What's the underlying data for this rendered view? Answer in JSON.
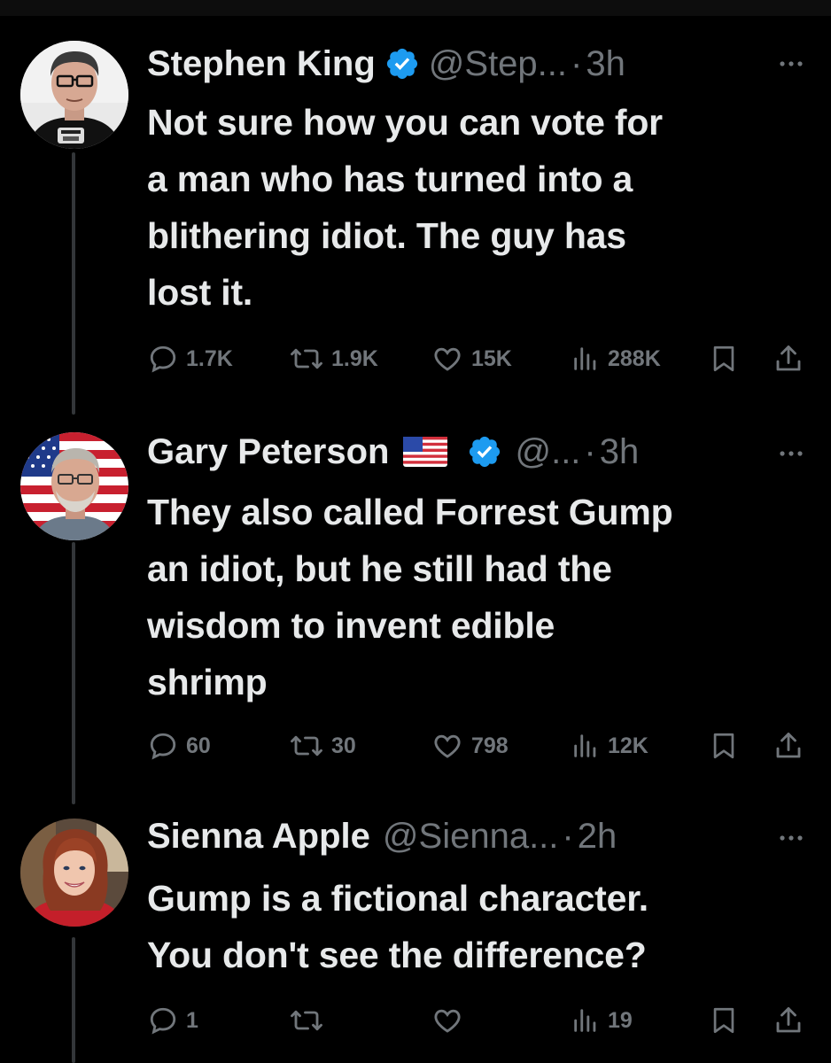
{
  "tweets": [
    {
      "display_name": "Stephen King",
      "verified": true,
      "handle": "@Step...",
      "separator": "·",
      "time": "3h",
      "text_lines": [
        "Not sure how you can vote for",
        "a man who has turned into a",
        "blithering idiot. The guy has",
        "lost it."
      ],
      "replies": "1.7K",
      "reposts": "1.9K",
      "likes": "15K",
      "views": "288K",
      "avatar": "person-glasses-black-shirt"
    },
    {
      "display_name": "Gary Peterson",
      "flag": "us-flag-emoji",
      "verified": true,
      "handle": "@...",
      "separator": "·",
      "time": "3h",
      "text_lines": [
        "They also called Forrest Gump",
        "an idiot, but he still had the",
        "wisdom to invent edible",
        "shrimp"
      ],
      "replies": "60",
      "reposts": "30",
      "likes": "798",
      "views": "12K",
      "avatar": "older-man-glasses-flag-background"
    },
    {
      "display_name": "Sienna Apple",
      "verified": false,
      "handle": "@Sienna...",
      "separator": "·",
      "time": "2h",
      "text_lines": [
        "Gump is a fictional character.",
        "You don't see the difference?"
      ],
      "replies": "1",
      "reposts": "",
      "likes": "",
      "views": "19",
      "avatar": "woman-red-hair"
    }
  ],
  "icons": {
    "reply": "reply-icon",
    "repost": "repost-icon",
    "like": "heart-icon",
    "views": "views-icon",
    "bookmark": "bookmark-icon",
    "share": "share-icon",
    "more": "more-icon",
    "verified": "verified-badge-icon"
  },
  "colors": {
    "background": "#000000",
    "text": "#e7e9ea",
    "muted": "#71767b",
    "verified": "#1d9bf0",
    "thread_line": "#333639"
  }
}
